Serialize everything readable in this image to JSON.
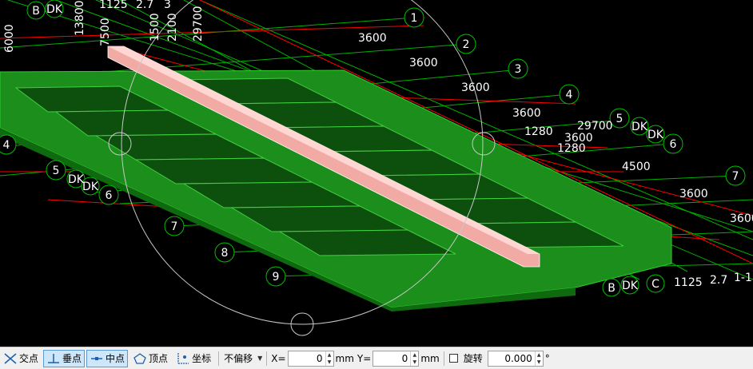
{
  "viewport": {
    "axis_bubbles_right": [
      "1",
      "2",
      "3",
      "4",
      "5",
      "6",
      "7"
    ],
    "axis_bubbles_left": [
      "4",
      "5",
      "6",
      "7",
      "8",
      "9"
    ],
    "axis_letters_top": [
      "B",
      "DK"
    ],
    "axis_letters_right": [
      "DK",
      "DK"
    ],
    "axis_letters_left": [
      "DK",
      "DK"
    ],
    "axis_letters_bottom": [
      "B",
      "DK",
      "C"
    ],
    "dimensions_right": [
      "3600",
      "3600",
      "3600",
      "3600",
      "1280",
      "29700",
      "3600",
      "1280",
      "4500",
      "3600",
      "3600"
    ],
    "dimensions_top": [
      "13800",
      "7500",
      "1500",
      "2100",
      "29700",
      "6000",
      "1125",
      "2.7",
      "3",
      "1125",
      "2.7",
      "1-1"
    ],
    "colors": {
      "background": "#000000",
      "axis_lines": "#00c000",
      "grid_red": "#ff0000",
      "slab_green": "#1f9a1f",
      "beam_pink": "#f2b0ab",
      "cursor_circle": "#c8c8c8"
    }
  },
  "toolbar": {
    "snap_intersection": "交点",
    "snap_perpendicular": "垂点",
    "snap_midpoint": "中点",
    "snap_vertex": "顶点",
    "snap_coordinate": "坐标",
    "offset_mode": "不偏移",
    "x_label": "X=",
    "x_value": "0",
    "x_unit": "mm",
    "y_label": "Y=",
    "y_value": "0",
    "y_unit": "mm",
    "rotate_label": "旋转",
    "rotate_value": "0.000",
    "degree_symbol": "°",
    "active_snaps": [
      "垂点",
      "中点"
    ]
  }
}
